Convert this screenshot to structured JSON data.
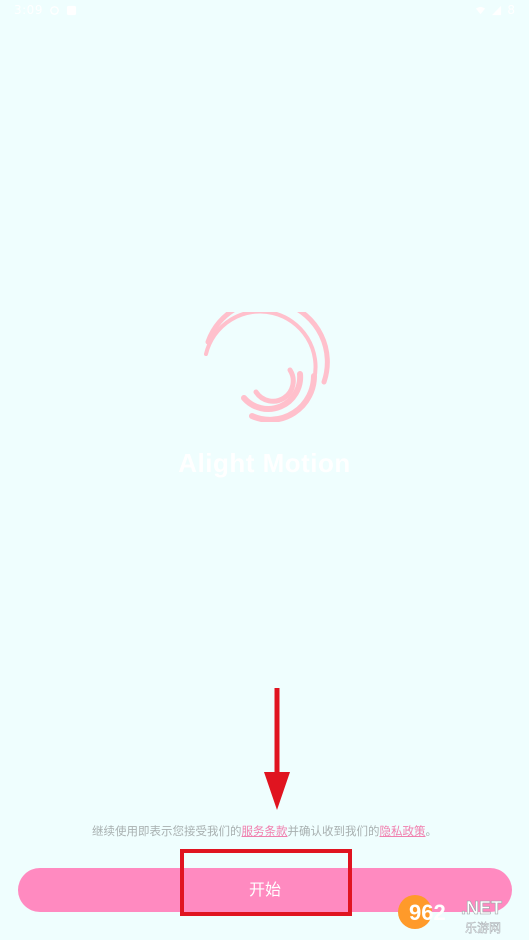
{
  "status_bar": {
    "time": "3:09",
    "battery": "8"
  },
  "logo": {
    "icon": "alight-motion-swirl-logo",
    "brand_name": "Alight Motion",
    "color": "#ffc0cc"
  },
  "terms": {
    "prefix": "继续使用即表示您接受我们的",
    "terms_link": "服务条款",
    "middle": "并确认收到我们的",
    "privacy_link": "隐私政策",
    "suffix": "。"
  },
  "start_button": {
    "label": "开始",
    "color": "#ff8ac0"
  },
  "annotation": {
    "color": "#e01420"
  },
  "watermark": {
    "number": "962",
    "suffix": ".NET",
    "subtitle": "乐游网"
  }
}
